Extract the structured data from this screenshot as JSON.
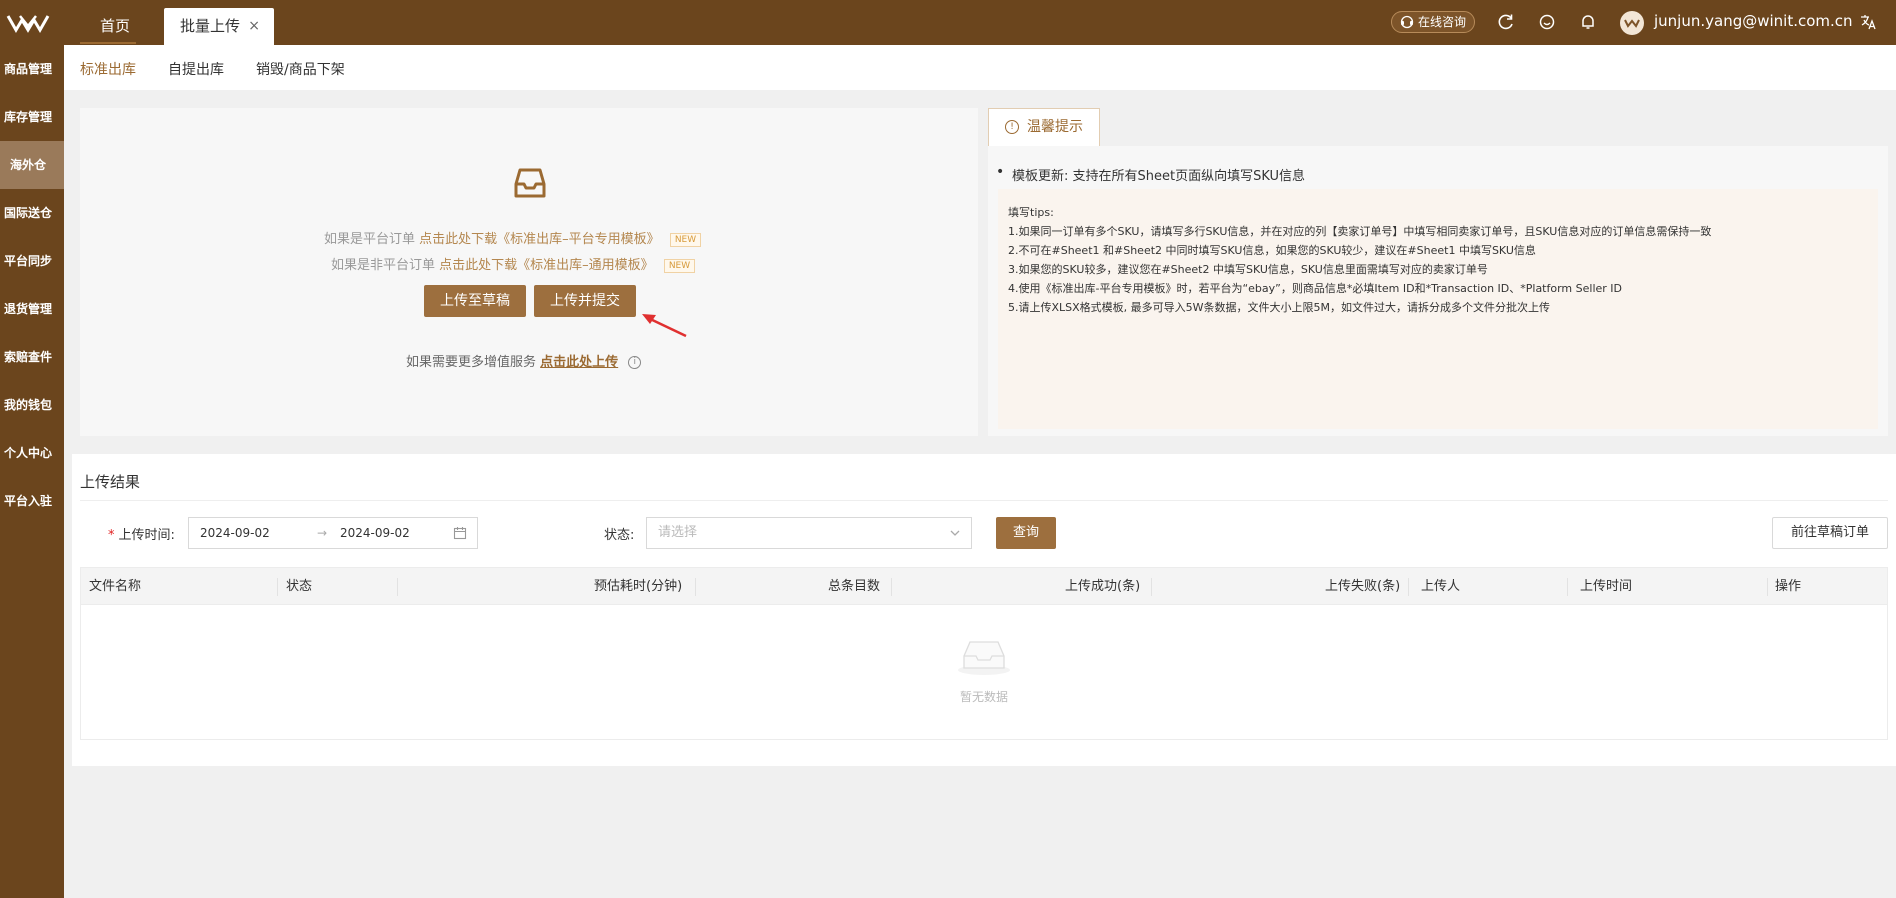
{
  "topbar": {
    "tabs": [
      {
        "label": "首页"
      },
      {
        "label": "批量上传"
      }
    ],
    "consult_label": "在线咨询",
    "user_email": "junjun.yang@winit.com.cn"
  },
  "sidebar": {
    "items": [
      {
        "label": "商品管理"
      },
      {
        "label": "库存管理"
      },
      {
        "label": "海外仓"
      },
      {
        "label": "国际送仓"
      },
      {
        "label": "平台同步"
      },
      {
        "label": "退货管理"
      },
      {
        "label": "索赔查件"
      },
      {
        "label": "我的钱包"
      },
      {
        "label": "个人中心"
      },
      {
        "label": "平台入驻"
      }
    ],
    "active_index": 2
  },
  "subnav": {
    "tabs": [
      {
        "label": "标准出库"
      },
      {
        "label": "自提出库"
      },
      {
        "label": "销毁/商品下架"
      }
    ]
  },
  "upload": {
    "line1_prefix": "如果是平台订单",
    "line1_link": "点击此处下载《标准出库–平台专用模板》",
    "line2_prefix": "如果是非平台订单",
    "line2_link": "点击此处下载《标准出库–通用模板》",
    "new_badge": "NEW",
    "draft_button": "上传至草稿",
    "submit_button": "上传并提交",
    "more_text": "如果需要更多增值服务",
    "more_link": "点击此处上传"
  },
  "tips": {
    "tab_label": "温馨提示",
    "bullet": "模板更新: 支持在所有Sheet页面纵向填写SKU信息",
    "title": "填写tips:",
    "lines": [
      "1.如果同一订单有多个SKU，请填写多行SKU信息，并在对应的列【卖家订单号】中填写相同卖家订单号，且SKU信息对应的订单信息需保持一致",
      "2.不可在#Sheet1 和#Sheet2 中同时填写SKU信息，如果您的SKU较少，建议在#Sheet1 中填写SKU信息",
      "3.如果您的SKU较多，建议您在#Sheet2 中填写SKU信息，SKU信息里面需填写对应的卖家订单号",
      "4.使用《标准出库-平台专用模板》时，若平台为“ebay”，则商品信息*必填Item ID和*Transaction ID、*Platform Seller ID",
      "5.请上传XLSX格式模板, 最多可导入5W条数据，文件大小上限5M，如文件过大，请拆分成多个文件分批次上传"
    ]
  },
  "results": {
    "title": "上传结果",
    "upload_time_label": "上传时间:",
    "date_start": "2024-09-02",
    "date_end": "2024-09-02",
    "status_label": "状态:",
    "status_placeholder": "请选择",
    "query_button": "查询",
    "drafts_button": "前往草稿订单",
    "columns": [
      "文件名称",
      "状态",
      "预估耗时(分钟)",
      "总条目数",
      "上传成功(条)",
      "上传失败(条)",
      "上传人",
      "上传时间",
      "操作"
    ],
    "empty_text": "暂无数据"
  }
}
